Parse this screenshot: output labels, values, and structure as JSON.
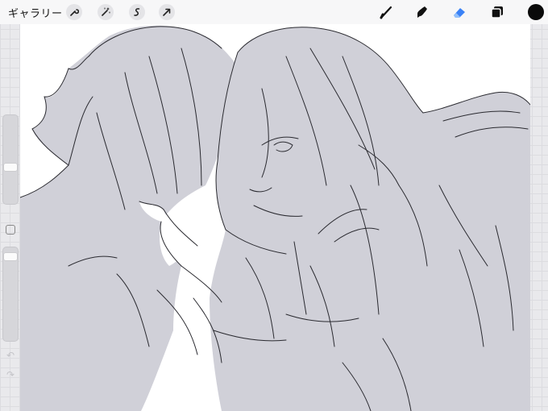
{
  "toolbar": {
    "gallery_label": "ギャラリー",
    "left_tools": [
      "wrench-icon",
      "magic-wand-icon",
      "selection-icon",
      "transform-arrow-icon"
    ],
    "right_tools": [
      "brush-icon",
      "smudge-icon",
      "eraser-icon",
      "layers-icon"
    ],
    "active_tool": "eraser-icon",
    "active_color": "#0a0a0a",
    "accent_color": "#3b82f6"
  },
  "sidebar": {
    "brush_size_level": 0.4,
    "opacity_level": 0.95,
    "icons": [
      "modify-square-icon",
      "undo-icon",
      "redo-icon"
    ]
  },
  "canvas": {
    "background": "#ffffff",
    "fill_color": "#d0d0d8",
    "stroke_color": "#2a2a30"
  }
}
